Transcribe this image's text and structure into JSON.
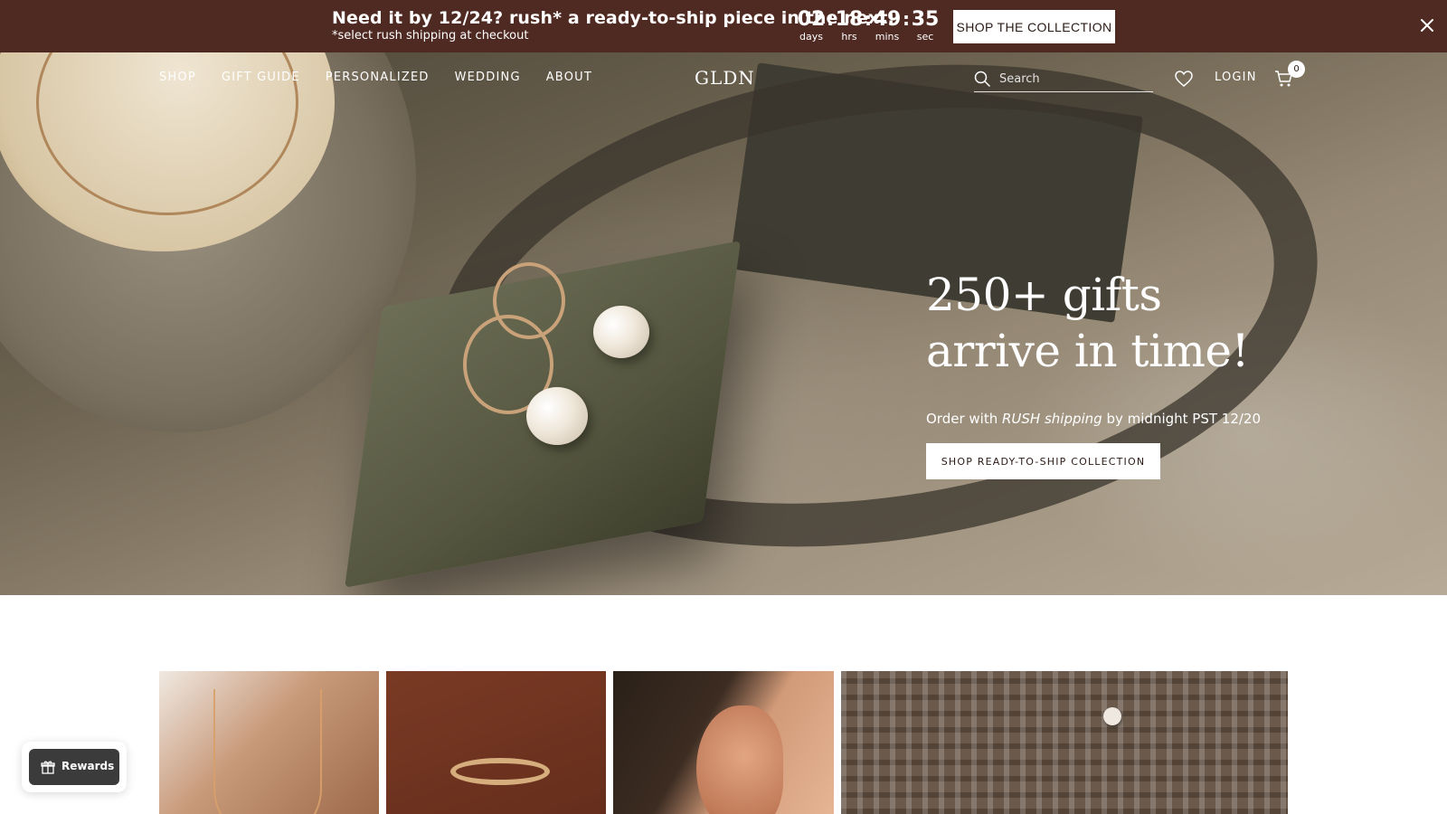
{
  "announcement": {
    "message": "Need it by 12/24? rush* a ready-to-ship piece in the next:",
    "sub_message": "*select rush shipping at checkout",
    "countdown": [
      {
        "value": "02",
        "label": "days"
      },
      {
        "value": "18",
        "label": "hrs"
      },
      {
        "value": "49",
        "label": "mins"
      },
      {
        "value": "35",
        "label": "sec"
      }
    ],
    "separator": ":",
    "cta_label": "SHOP THE COLLECTION",
    "close_icon": "close-icon",
    "background_color": "#4f2a22"
  },
  "nav": {
    "menu": [
      "SHOP",
      "GIFT GUIDE",
      "PERSONALIZED",
      "WEDDING",
      "ABOUT"
    ],
    "logo": "GLDN",
    "search_placeholder": "Search",
    "search_icon": "search-icon",
    "wishlist_icon": "heart-icon",
    "login_label": "LOGIN",
    "cart_icon": "cart-icon",
    "cart_count": "0"
  },
  "hero": {
    "heading": "250+ gifts arrive in time!",
    "lead_before": "Order with ",
    "lead_emphasis": "RUSH shipping",
    "lead_after": " by midnight PST 12/20",
    "cta_label": "SHOP READY-TO-SHIP COLLECTION"
  },
  "rewards": {
    "label": "Rewards",
    "icon": "gift-icon"
  }
}
